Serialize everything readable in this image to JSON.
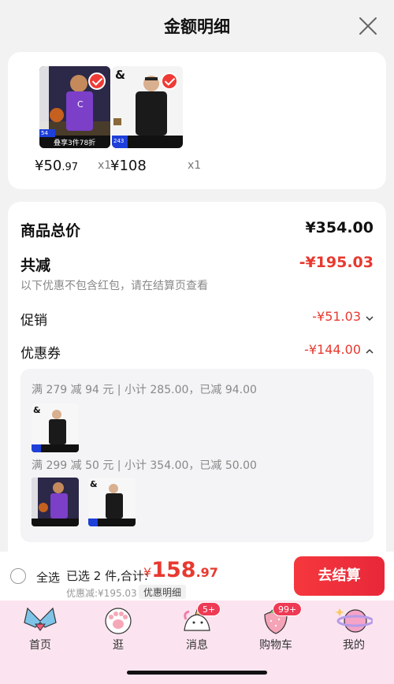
{
  "header": {
    "title": "金额明细",
    "close_icon": "close-icon"
  },
  "products": [
    {
      "price_int": "¥50",
      "price_dec": ".97",
      "qty": "x1",
      "overlay": "叠享3件78折",
      "tag": "54",
      "colors": {
        "bg": "#3a3160",
        "jersey": "#7b3fc8"
      }
    },
    {
      "price_int": "¥108",
      "price_dec": "",
      "qty": "x1",
      "overlay": "",
      "tag": "243",
      "colors": {
        "bg": "#f6f6f6",
        "jersey": "#1a1a1a"
      }
    }
  ],
  "detail": {
    "total_label": "商品总价",
    "total_value": "¥354.00",
    "reduce_label": "共减",
    "reduce_value": "-¥195.03",
    "reduce_note": "以下优惠不包含红包，请在结算页查看",
    "promo_label": "促销",
    "promo_value": "-¥51.03",
    "coupon_label": "优惠券",
    "coupon_value": "-¥144.00",
    "coupon_lines": [
      "满 279 减 94 元 | 小计 285.00，已减 94.00",
      "满 299 减 50 元 | 小计 354.00，已减 50.00"
    ]
  },
  "bottom": {
    "select_all": "全选",
    "summary": "已选 2 件,合计:",
    "total_sym": "¥",
    "total_int": "158",
    "total_dec": ".97",
    "discount": "优惠减:¥195.03",
    "discount_link": "优惠明细",
    "checkout": "去结算"
  },
  "tabbar": [
    {
      "label": "首页",
      "icon": "sailor-collar-icon"
    },
    {
      "label": "逛",
      "icon": "paw-icon"
    },
    {
      "label": "消息",
      "icon": "unicorn-icon",
      "badge": "5+"
    },
    {
      "label": "购物车",
      "icon": "strawberry-icon",
      "badge": "99+"
    },
    {
      "label": "我的",
      "icon": "planet-icon"
    }
  ],
  "colors": {
    "accent_red": "#e8392f",
    "tabbar_bg": "#fbe4ef",
    "badge": "#ee3a55"
  }
}
